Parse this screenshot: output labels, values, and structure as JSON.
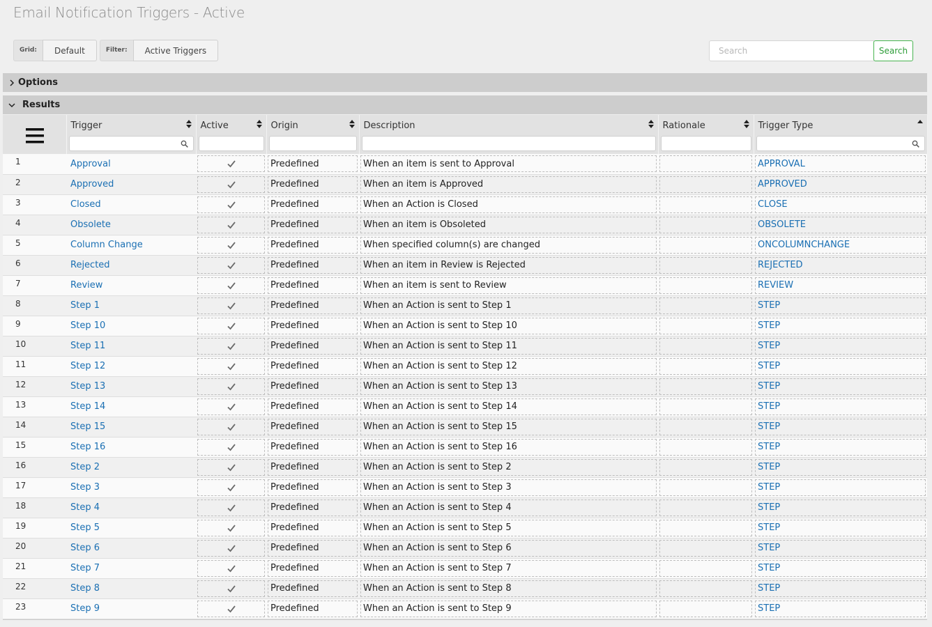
{
  "page": {
    "title": "Email Notification Triggers - Active"
  },
  "toolbar": {
    "grid_label": "Grid:",
    "grid_value": "Default",
    "filter_label": "Filter:",
    "filter_value": "Active Triggers"
  },
  "search": {
    "placeholder": "Search",
    "button": "Search"
  },
  "panels": {
    "options": "Options",
    "results": "Results"
  },
  "colors": {
    "link": "#1a6fb3",
    "search_button": "#2d9c38",
    "panel_bar": "#cdcdcd"
  },
  "table": {
    "columns": [
      {
        "key": "trigger",
        "label": "Trigger",
        "sort": "both",
        "filter_icon": "magnifier-icon"
      },
      {
        "key": "active",
        "label": "Active",
        "sort": "both"
      },
      {
        "key": "origin",
        "label": "Origin",
        "sort": "both"
      },
      {
        "key": "description",
        "label": "Description",
        "sort": "both"
      },
      {
        "key": "rationale",
        "label": "Rationale",
        "sort": "both"
      },
      {
        "key": "trigger_type",
        "label": "Trigger Type",
        "sort": "asc",
        "filter_icon": "magnifier-icon"
      }
    ],
    "rows": [
      {
        "n": "1",
        "trigger": "Approval",
        "origin": "Predefined",
        "description": "When an item is sent to Approval",
        "rationale": "",
        "trigger_type": "APPROVAL"
      },
      {
        "n": "2",
        "trigger": "Approved",
        "origin": "Predefined",
        "description": "When an item is Approved",
        "rationale": "",
        "trigger_type": "APPROVED"
      },
      {
        "n": "3",
        "trigger": "Closed",
        "origin": "Predefined",
        "description": "When an Action is Closed",
        "rationale": "",
        "trigger_type": "CLOSE"
      },
      {
        "n": "4",
        "trigger": "Obsolete",
        "origin": "Predefined",
        "description": "When an item is Obsoleted",
        "rationale": "",
        "trigger_type": "OBSOLETE"
      },
      {
        "n": "5",
        "trigger": "Column Change",
        "origin": "Predefined",
        "description": "When specified column(s) are changed",
        "rationale": "",
        "trigger_type": "ONCOLUMNCHANGE"
      },
      {
        "n": "6",
        "trigger": "Rejected",
        "origin": "Predefined",
        "description": "When an item in Review is Rejected",
        "rationale": "",
        "trigger_type": "REJECTED"
      },
      {
        "n": "7",
        "trigger": "Review",
        "origin": "Predefined",
        "description": "When an item is sent to Review",
        "rationale": "",
        "trigger_type": "REVIEW"
      },
      {
        "n": "8",
        "trigger": "Step 1",
        "origin": "Predefined",
        "description": "When an Action is sent to Step 1",
        "rationale": "",
        "trigger_type": "STEP"
      },
      {
        "n": "9",
        "trigger": "Step 10",
        "origin": "Predefined",
        "description": "When an Action is sent to Step 10",
        "rationale": "",
        "trigger_type": "STEP"
      },
      {
        "n": "10",
        "trigger": "Step 11",
        "origin": "Predefined",
        "description": "When an Action is sent to Step 11",
        "rationale": "",
        "trigger_type": "STEP"
      },
      {
        "n": "11",
        "trigger": "Step 12",
        "origin": "Predefined",
        "description": "When an Action is sent to Step 12",
        "rationale": "",
        "trigger_type": "STEP"
      },
      {
        "n": "12",
        "trigger": "Step 13",
        "origin": "Predefined",
        "description": "When an Action is sent to Step 13",
        "rationale": "",
        "trigger_type": "STEP"
      },
      {
        "n": "13",
        "trigger": "Step 14",
        "origin": "Predefined",
        "description": "When an Action is sent to Step 14",
        "rationale": "",
        "trigger_type": "STEP"
      },
      {
        "n": "14",
        "trigger": "Step 15",
        "origin": "Predefined",
        "description": "When an Action is sent to Step 15",
        "rationale": "",
        "trigger_type": "STEP"
      },
      {
        "n": "15",
        "trigger": "Step 16",
        "origin": "Predefined",
        "description": "When an Action is sent to Step 16",
        "rationale": "",
        "trigger_type": "STEP"
      },
      {
        "n": "16",
        "trigger": "Step 2",
        "origin": "Predefined",
        "description": "When an Action is sent to Step 2",
        "rationale": "",
        "trigger_type": "STEP"
      },
      {
        "n": "17",
        "trigger": "Step 3",
        "origin": "Predefined",
        "description": "When an Action is sent to Step 3",
        "rationale": "",
        "trigger_type": "STEP"
      },
      {
        "n": "18",
        "trigger": "Step 4",
        "origin": "Predefined",
        "description": "When an Action is sent to Step 4",
        "rationale": "",
        "trigger_type": "STEP"
      },
      {
        "n": "19",
        "trigger": "Step 5",
        "origin": "Predefined",
        "description": "When an Action is sent to Step 5",
        "rationale": "",
        "trigger_type": "STEP"
      },
      {
        "n": "20",
        "trigger": "Step 6",
        "origin": "Predefined",
        "description": "When an Action is sent to Step 6",
        "rationale": "",
        "trigger_type": "STEP"
      },
      {
        "n": "21",
        "trigger": "Step 7",
        "origin": "Predefined",
        "description": "When an Action is sent to Step 7",
        "rationale": "",
        "trigger_type": "STEP"
      },
      {
        "n": "22",
        "trigger": "Step 8",
        "origin": "Predefined",
        "description": "When an Action is sent to Step 8",
        "rationale": "",
        "trigger_type": "STEP"
      },
      {
        "n": "23",
        "trigger": "Step 9",
        "origin": "Predefined",
        "description": "When an Action is sent to Step 9",
        "rationale": "",
        "trigger_type": "STEP"
      }
    ]
  }
}
